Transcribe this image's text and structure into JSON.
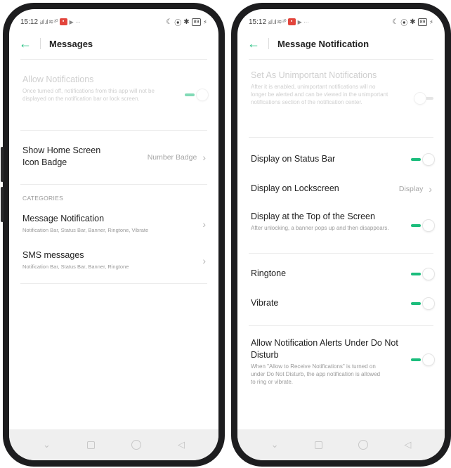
{
  "status_bar": {
    "time": "15:12",
    "left_icons": "ᵢₗ.ıl .ıl ≋ ²⁰",
    "battery": "89"
  },
  "left_screen": {
    "header": {
      "title": "Messages"
    },
    "allow_notifications": {
      "title": "Allow Notifications",
      "subtitle": "Once turned off, notifications from this app will not be displayed on the notification bar or lock screen.",
      "state": "on-disabled"
    },
    "home_badge": {
      "title": "Show Home Screen Icon Badge",
      "value": "Number Badge"
    },
    "categories_label": "CATEGORIES",
    "categories": [
      {
        "title": "Message Notification",
        "subtitle": "Notification Bar, Status Bar, Banner, Ringtone, Vibrate"
      },
      {
        "title": "SMS messages",
        "subtitle": "Notification Bar, Status Bar, Banner, Ringtone"
      }
    ]
  },
  "right_screen": {
    "header": {
      "title": "Message Notification"
    },
    "unimportant": {
      "title": "Set As Unimportant Notifications",
      "subtitle": "After it is enabled, unimportant notifications will no longer be alerted and can be viewed in the unimportant notifications section of the notification center.",
      "state": "off-disabled"
    },
    "status_bar_row": {
      "title": "Display on Status Bar",
      "state": "on"
    },
    "lockscreen_row": {
      "title": "Display on Lockscreen",
      "value": "Display"
    },
    "top_screen_row": {
      "title": "Display at the Top of the Screen",
      "subtitle": "After unlocking, a banner pops up and then disappears.",
      "state": "on"
    },
    "ringtone_row": {
      "title": "Ringtone",
      "state": "on"
    },
    "vibrate_row": {
      "title": "Vibrate",
      "state": "on"
    },
    "dnd_row": {
      "title": "Allow Notification Alerts Under Do Not Disturb",
      "subtitle": "When \"Allow to Receive Notifications\" is turned on under Do Not Disturb, the app notification is allowed to ring or vibrate.",
      "state": "on"
    }
  },
  "accent_color": "#1bbd7c",
  "icons": [
    "back-arrow-icon",
    "chevron-right-icon",
    "nav-back-icon",
    "nav-home-icon",
    "nav-recents-icon",
    "nav-down-icon"
  ]
}
